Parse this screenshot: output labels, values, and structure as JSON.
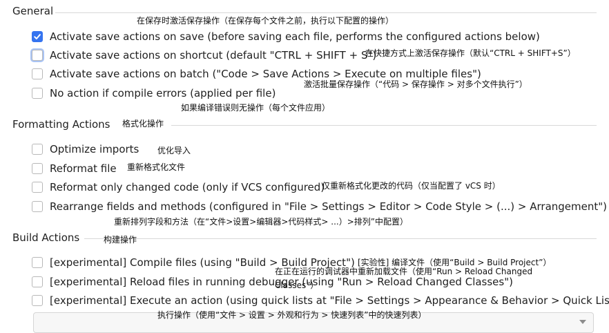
{
  "sections": {
    "general": {
      "title": "General",
      "items": [
        {
          "label": "Activate save actions on save (before saving each file, performs the configured actions below)",
          "checked": true,
          "note": "在保存时激活保存操作（在保存每个文件之前，执行以下配置的操作）"
        },
        {
          "label": "Activate save actions on shortcut (default \"CTRL + SHIFT + S\")",
          "checked": false,
          "note": "在快捷方式上激活保存操作（默认“CTRL + SHIFT+S”）"
        },
        {
          "label": "Activate save actions on batch (\"Code > Save Actions > Execute on multiple files\")",
          "checked": false,
          "note": "激活批量保存操作（“代码 > 保存操作 > 对多个文件执行”）"
        },
        {
          "label": "No action if compile errors (applied per file)",
          "checked": false,
          "note": "如果编译错误则无操作（每个文件应用）"
        }
      ]
    },
    "formatting": {
      "title": "Formatting Actions",
      "title_note": "格式化操作",
      "items": [
        {
          "label": "Optimize imports",
          "checked": false,
          "note": "优化导入"
        },
        {
          "label": "Reformat file",
          "checked": false,
          "note": "重新格式化文件"
        },
        {
          "label": "Reformat only changed code (only if VCS configured)",
          "checked": false,
          "note": "仅重新格式化更改的代码（仅当配置了 vCS 时）"
        },
        {
          "label": "Rearrange fields and methods (configured in \"File > Settings > Editor > Code Style > (...) > Arrangement\")",
          "checked": false,
          "note": "重新排列字段和方法（在“文件>设置>编辑器>代码样式> ...）>排列”中配置）"
        }
      ]
    },
    "build": {
      "title": "Build Actions",
      "title_note": "构建操作",
      "items": [
        {
          "label": "[experimental] Compile files (using \"Build > Build Project\")",
          "checked": false,
          "note": "[实验性] 编译文件（使用“Build > Build Project”）"
        },
        {
          "label": "[experimental] Reload files in running debugger (using \"Run > Reload Changed Classes\")",
          "checked": false,
          "note": "在正在运行的调试器中重新加载文件（使用“Run > Reload Changed",
          "note2": "Classes”）"
        },
        {
          "label": "[experimental] Execute an action (using quick lists at \"File > Settings > Appearance & Behavior > Quick Lists\")",
          "checked": false,
          "note": "执行操作（使用“文件 > 设置 > 外观和行为 > 快速列表”中的快速列表）"
        }
      ]
    }
  },
  "colors": {
    "accent": "#3574f0",
    "text": "#1f1f1f",
    "border": "#b8b8b8"
  }
}
